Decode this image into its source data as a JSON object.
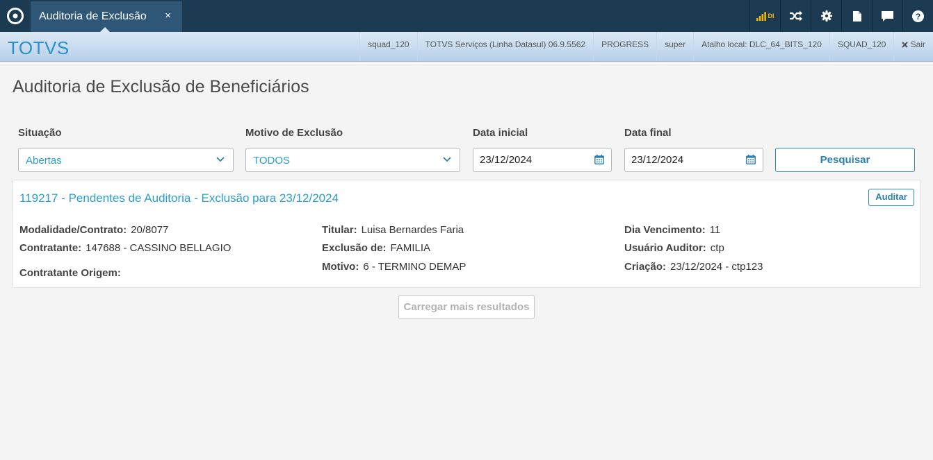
{
  "topbar": {
    "tab_title": "Auditoria de Exclusão",
    "tab_close": "×",
    "di_label": "DI"
  },
  "infobar": {
    "brand": "TOTVS",
    "items": [
      "squad_120",
      "TOTVS Serviços (Linha Datasul) 06.9.5562",
      "PROGRESS",
      "super",
      "Atalho local: DLC_64_BITS_120",
      "SQUAD_120"
    ],
    "logout": "Sair"
  },
  "page": {
    "title": "Auditoria de Exclusão de Beneficiários"
  },
  "filters": {
    "situacao_label": "Situação",
    "situacao_value": "Abertas",
    "motivo_label": "Motivo de Exclusão",
    "motivo_value": "TODOS",
    "data_inicial_label": "Data inicial",
    "data_inicial_value": "23/12/2024",
    "data_final_label": "Data final",
    "data_final_value": "23/12/2024",
    "search_button": "Pesquisar"
  },
  "card": {
    "title": "119217 - Pendentes de Auditoria - Exclusão para 23/12/2024",
    "audit_button": "Auditar",
    "fields": {
      "modalidade_k": "Modalidade/Contrato:",
      "modalidade_v": "20/8077",
      "contratante_k": "Contratante:",
      "contratante_v": "147688 - CASSINO BELLAGIO",
      "contratante_origem_k": "Contratante Origem:",
      "titular_k": "Titular:",
      "titular_v": "Luisa Bernardes Faria",
      "exclusao_k": "Exclusão de:",
      "exclusao_v": "FAMILIA",
      "motivo_k": "Motivo:",
      "motivo_v": "6 - TERMINO DEMAP",
      "dia_venc_k": "Dia Vencimento:",
      "dia_venc_v": "11",
      "usuario_k": "Usuário Auditor:",
      "usuario_v": "ctp",
      "criacao_k": "Criação:",
      "criacao_v": "23/12/2024 - ctp123"
    }
  },
  "load_more": "Carregar mais resultados",
  "colors": {
    "topbar": "#1c3a52",
    "accent": "#2a9ec8",
    "brand": "#2b8fcb"
  }
}
